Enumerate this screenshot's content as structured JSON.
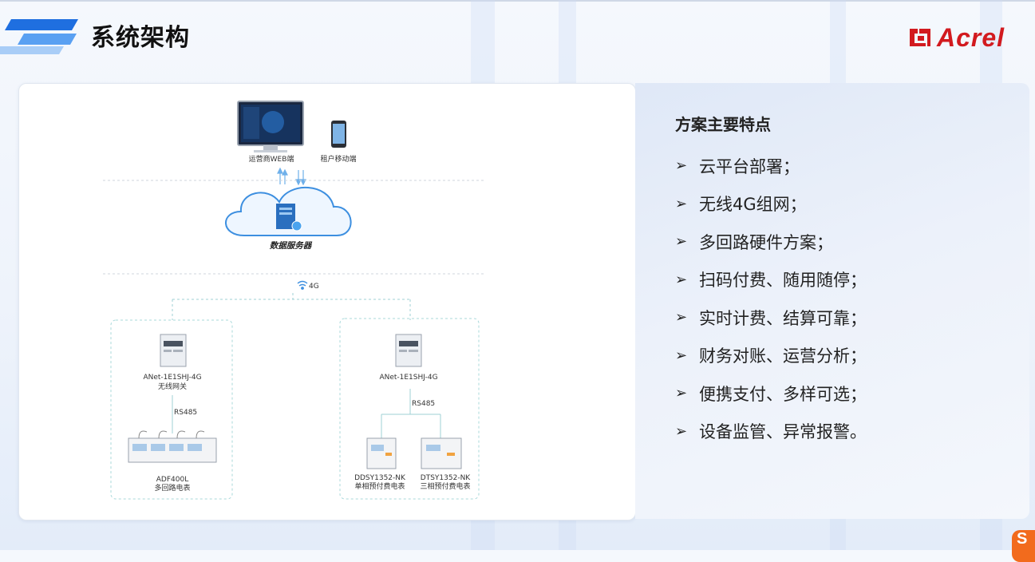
{
  "page": {
    "title": "系统架构",
    "logo_text": "Acrel",
    "brand_color": "#d21a1f",
    "accent_color": "#1f6fe0"
  },
  "diagram": {
    "web_client_label": "运营商WEB端",
    "mobile_client_label": "租户移动端",
    "server_label": "数据服务器",
    "network_label": "4G",
    "left_group": {
      "gateway_model": "ANet-1E1SHJ-4G",
      "gateway_desc": "无线网关",
      "bus_label": "RS485",
      "meter_model": "ADF400L",
      "meter_desc": "多回路电表"
    },
    "right_group": {
      "gateway_model": "ANet-1E1SHJ-4G",
      "bus_label": "RS485",
      "meter1_model": "DDSY1352-NK",
      "meter1_desc": "单相预付费电表",
      "meter2_model": "DTSY1352-NK",
      "meter2_desc": "三相预付费电表"
    }
  },
  "features": {
    "title": "方案主要特点",
    "bullet_icon": "arrowhead-bullet-icon",
    "items": [
      "云平台部署；",
      "无线4G组网；",
      "多回路硬件方案；",
      "扫码付费、随用随停；",
      "实时计费、结算可靠；",
      "财务对账、运营分析；",
      "便携支付、多样可选；",
      "设备监管、异常报警。"
    ]
  }
}
